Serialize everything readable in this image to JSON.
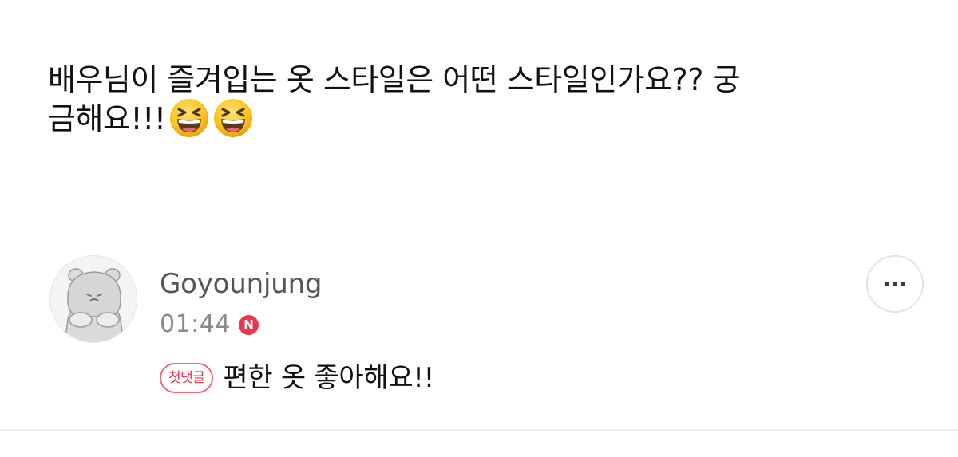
{
  "post": {
    "line1": "배우님이 즐겨입는 옷 스타일은 어떤 스타일인가요?? 궁",
    "line2": "금해요!!!",
    "emoji_icons": [
      "grinning-squinting-face-icon",
      "grinning-squinting-face-icon"
    ]
  },
  "comment": {
    "avatar_icon": "hippo-avatar-icon",
    "author": "Goyounjung",
    "time": "01:44",
    "new_badge": "N",
    "first_comment_badge": "첫댓글",
    "text": "편한 옷 좋아해요!!",
    "more_icon": "more-horizontal-icon"
  },
  "colors": {
    "badge_red": "#e8384f",
    "time_gray": "#8a8a8a",
    "author_gray": "#555555"
  }
}
